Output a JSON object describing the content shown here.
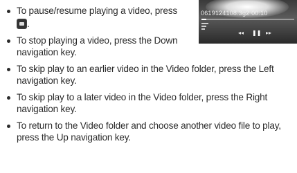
{
  "player_screen": {
    "info_text": "0619124108.3g2  00:10",
    "progress": 0.05,
    "controls": {
      "prev_icon": "skip-back-icon",
      "play_icon": "pause-icon",
      "next_icon": "skip-forward-icon"
    }
  },
  "instructions": [
    {
      "id": "pause",
      "text": "To pause/resume playing a video, press"
    },
    {
      "id": "pause-end",
      "text": "."
    },
    {
      "id": "stop",
      "text": "To stop playing a video, press the Down navigation key."
    },
    {
      "id": "left",
      "text": "To skip play to an earlier video in the Video folder, press the Left navigation key."
    },
    {
      "id": "right",
      "text": "To skip play to a later video in the Video folder, press the Right navigation key."
    },
    {
      "id": "up",
      "text": "To return to the Video folder and choose another video file to play, press the Up navigation key."
    }
  ],
  "icons": {
    "key": "center-key-icon",
    "bullet": "bullet-dot"
  }
}
